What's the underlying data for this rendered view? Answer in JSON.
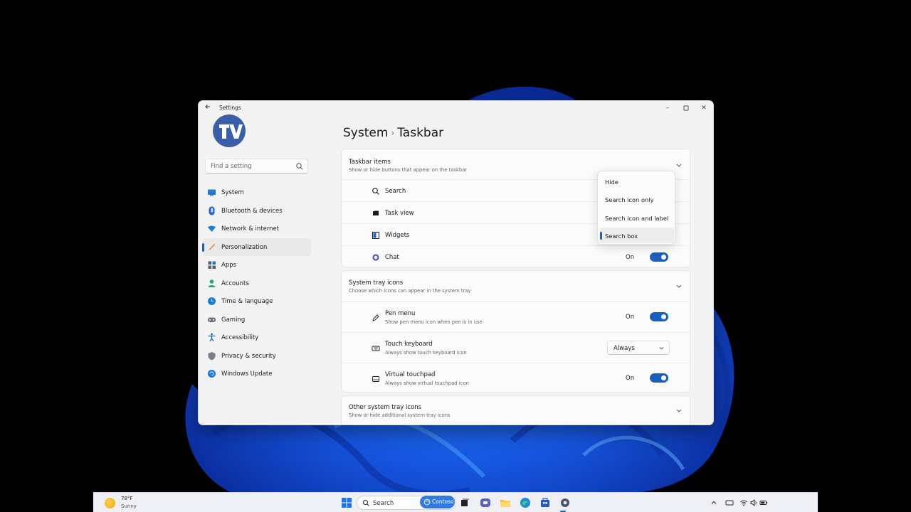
{
  "window": {
    "title": "Settings",
    "logo_text": "TV",
    "search_placeholder": "Find a setting"
  },
  "sidebar": {
    "items": [
      {
        "label": "System",
        "icon": "system-icon",
        "color": "#1c7ad8"
      },
      {
        "label": "Bluetooth & devices",
        "icon": "bluetooth-icon",
        "color": "#1a66d1"
      },
      {
        "label": "Network & internet",
        "icon": "wifi-icon",
        "color": "#1b7fd6"
      },
      {
        "label": "Personalization",
        "icon": "brush-icon",
        "color": "#e9803a",
        "selected": true
      },
      {
        "label": "Apps",
        "icon": "apps-icon",
        "color": "#5a5f6a"
      },
      {
        "label": "Accounts",
        "icon": "account-icon",
        "color": "#2aa57a"
      },
      {
        "label": "Time & language",
        "icon": "globe-clock-icon",
        "color": "#1b80d4"
      },
      {
        "label": "Gaming",
        "icon": "gamepad-icon",
        "color": "#6b6f78"
      },
      {
        "label": "Accessibility",
        "icon": "accessibility-icon",
        "color": "#1d65c9"
      },
      {
        "label": "Privacy & security",
        "icon": "shield-icon",
        "color": "#7a7f88"
      },
      {
        "label": "Windows Update",
        "icon": "update-icon",
        "color": "#1c7ad8"
      }
    ]
  },
  "breadcrumb": {
    "parent": "System",
    "separator": "›",
    "current": "Taskbar"
  },
  "sections": {
    "taskbar_items": {
      "title": "Taskbar items",
      "subtitle": "Show or hide buttons that appear on the taskbar",
      "rows": [
        {
          "label": "Search",
          "icon": "search-icon"
        },
        {
          "label": "Task view",
          "icon": "task-view-icon"
        },
        {
          "label": "Widgets",
          "icon": "widgets-icon"
        },
        {
          "label": "Chat",
          "icon": "chat-icon",
          "toggle_state": "On",
          "toggle_on": true
        }
      ]
    },
    "system_tray": {
      "title": "System tray icons",
      "subtitle": "Choose which icons can appear in the system tray",
      "rows": [
        {
          "label": "Pen menu",
          "sub": "Show pen menu icon when pen is in use",
          "icon": "pen-icon",
          "toggle_state": "On",
          "toggle_on": true
        },
        {
          "label": "Touch keyboard",
          "sub": "Always show touch keyboard icon",
          "icon": "keyboard-icon",
          "dropdown": "Always"
        },
        {
          "label": "Virtual touchpad",
          "sub": "Always show virtual touchpad icon",
          "icon": "touchpad-icon",
          "toggle_state": "On",
          "toggle_on": true
        }
      ]
    },
    "other_tray": {
      "title": "Other system tray icons",
      "subtitle": "Show or hide additional system tray icons"
    }
  },
  "search_menu": {
    "options": [
      "Hide",
      "Search icon only",
      "Search icon and label",
      "Search box"
    ],
    "selected": "Search box"
  },
  "taskbar": {
    "weather_temp": "78°F",
    "weather_condition": "Sunny",
    "search_label": "Search",
    "search_badge": "Contoso",
    "accent": "#1c60bf"
  }
}
